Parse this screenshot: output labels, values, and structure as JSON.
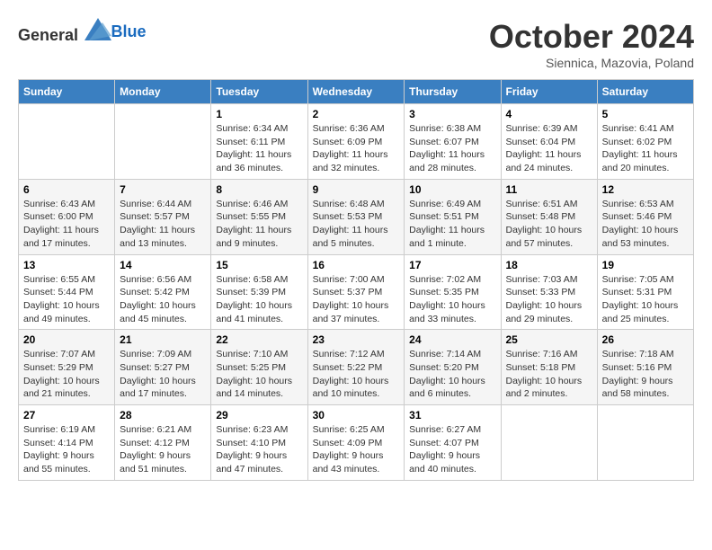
{
  "header": {
    "logo_general": "General",
    "logo_blue": "Blue",
    "month": "October 2024",
    "location": "Siennica, Mazovia, Poland"
  },
  "days_of_week": [
    "Sunday",
    "Monday",
    "Tuesday",
    "Wednesday",
    "Thursday",
    "Friday",
    "Saturday"
  ],
  "weeks": [
    [
      {
        "day": "",
        "info": ""
      },
      {
        "day": "",
        "info": ""
      },
      {
        "day": "1",
        "info": "Sunrise: 6:34 AM\nSunset: 6:11 PM\nDaylight: 11 hours and 36 minutes."
      },
      {
        "day": "2",
        "info": "Sunrise: 6:36 AM\nSunset: 6:09 PM\nDaylight: 11 hours and 32 minutes."
      },
      {
        "day": "3",
        "info": "Sunrise: 6:38 AM\nSunset: 6:07 PM\nDaylight: 11 hours and 28 minutes."
      },
      {
        "day": "4",
        "info": "Sunrise: 6:39 AM\nSunset: 6:04 PM\nDaylight: 11 hours and 24 minutes."
      },
      {
        "day": "5",
        "info": "Sunrise: 6:41 AM\nSunset: 6:02 PM\nDaylight: 11 hours and 20 minutes."
      }
    ],
    [
      {
        "day": "6",
        "info": "Sunrise: 6:43 AM\nSunset: 6:00 PM\nDaylight: 11 hours and 17 minutes."
      },
      {
        "day": "7",
        "info": "Sunrise: 6:44 AM\nSunset: 5:57 PM\nDaylight: 11 hours and 13 minutes."
      },
      {
        "day": "8",
        "info": "Sunrise: 6:46 AM\nSunset: 5:55 PM\nDaylight: 11 hours and 9 minutes."
      },
      {
        "day": "9",
        "info": "Sunrise: 6:48 AM\nSunset: 5:53 PM\nDaylight: 11 hours and 5 minutes."
      },
      {
        "day": "10",
        "info": "Sunrise: 6:49 AM\nSunset: 5:51 PM\nDaylight: 11 hours and 1 minute."
      },
      {
        "day": "11",
        "info": "Sunrise: 6:51 AM\nSunset: 5:48 PM\nDaylight: 10 hours and 57 minutes."
      },
      {
        "day": "12",
        "info": "Sunrise: 6:53 AM\nSunset: 5:46 PM\nDaylight: 10 hours and 53 minutes."
      }
    ],
    [
      {
        "day": "13",
        "info": "Sunrise: 6:55 AM\nSunset: 5:44 PM\nDaylight: 10 hours and 49 minutes."
      },
      {
        "day": "14",
        "info": "Sunrise: 6:56 AM\nSunset: 5:42 PM\nDaylight: 10 hours and 45 minutes."
      },
      {
        "day": "15",
        "info": "Sunrise: 6:58 AM\nSunset: 5:39 PM\nDaylight: 10 hours and 41 minutes."
      },
      {
        "day": "16",
        "info": "Sunrise: 7:00 AM\nSunset: 5:37 PM\nDaylight: 10 hours and 37 minutes."
      },
      {
        "day": "17",
        "info": "Sunrise: 7:02 AM\nSunset: 5:35 PM\nDaylight: 10 hours and 33 minutes."
      },
      {
        "day": "18",
        "info": "Sunrise: 7:03 AM\nSunset: 5:33 PM\nDaylight: 10 hours and 29 minutes."
      },
      {
        "day": "19",
        "info": "Sunrise: 7:05 AM\nSunset: 5:31 PM\nDaylight: 10 hours and 25 minutes."
      }
    ],
    [
      {
        "day": "20",
        "info": "Sunrise: 7:07 AM\nSunset: 5:29 PM\nDaylight: 10 hours and 21 minutes."
      },
      {
        "day": "21",
        "info": "Sunrise: 7:09 AM\nSunset: 5:27 PM\nDaylight: 10 hours and 17 minutes."
      },
      {
        "day": "22",
        "info": "Sunrise: 7:10 AM\nSunset: 5:25 PM\nDaylight: 10 hours and 14 minutes."
      },
      {
        "day": "23",
        "info": "Sunrise: 7:12 AM\nSunset: 5:22 PM\nDaylight: 10 hours and 10 minutes."
      },
      {
        "day": "24",
        "info": "Sunrise: 7:14 AM\nSunset: 5:20 PM\nDaylight: 10 hours and 6 minutes."
      },
      {
        "day": "25",
        "info": "Sunrise: 7:16 AM\nSunset: 5:18 PM\nDaylight: 10 hours and 2 minutes."
      },
      {
        "day": "26",
        "info": "Sunrise: 7:18 AM\nSunset: 5:16 PM\nDaylight: 9 hours and 58 minutes."
      }
    ],
    [
      {
        "day": "27",
        "info": "Sunrise: 6:19 AM\nSunset: 4:14 PM\nDaylight: 9 hours and 55 minutes."
      },
      {
        "day": "28",
        "info": "Sunrise: 6:21 AM\nSunset: 4:12 PM\nDaylight: 9 hours and 51 minutes."
      },
      {
        "day": "29",
        "info": "Sunrise: 6:23 AM\nSunset: 4:10 PM\nDaylight: 9 hours and 47 minutes."
      },
      {
        "day": "30",
        "info": "Sunrise: 6:25 AM\nSunset: 4:09 PM\nDaylight: 9 hours and 43 minutes."
      },
      {
        "day": "31",
        "info": "Sunrise: 6:27 AM\nSunset: 4:07 PM\nDaylight: 9 hours and 40 minutes."
      },
      {
        "day": "",
        "info": ""
      },
      {
        "day": "",
        "info": ""
      }
    ]
  ]
}
